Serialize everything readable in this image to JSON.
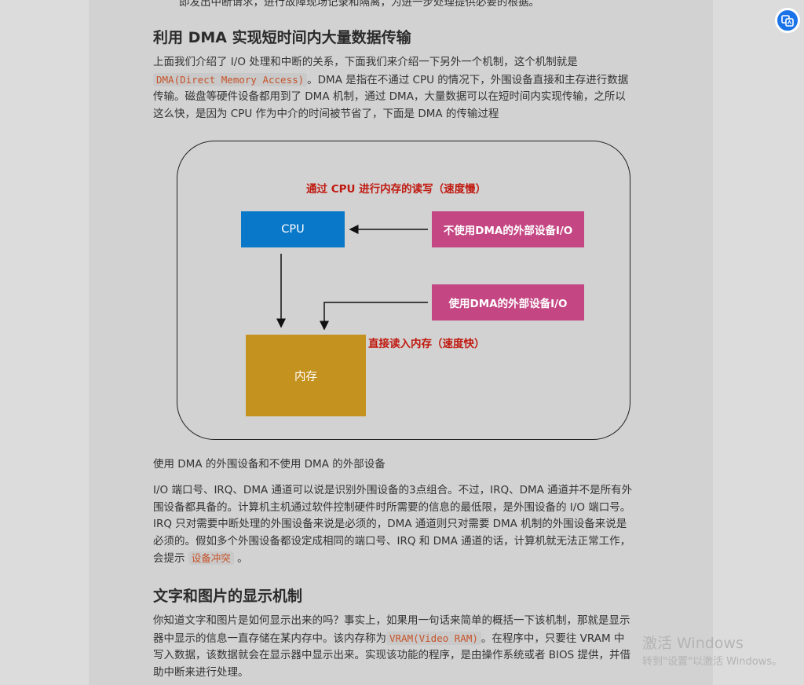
{
  "article": {
    "partial_top_line": "即发出中断请求，进行故障现场记录和隔离，为进一步处理提供必要的根据。",
    "section1": {
      "heading": "利用 DMA 实现短时间内大量数据传输",
      "p1_line1": "上面我们介绍了 I/O 处理和中断的关系，下面我们来介绍一下另外一个机制，这个机制就是",
      "p1_code": "DMA(Direct Memory Access)",
      "p1_line2_rest": "。DMA 是指在不通过 CPU 的情况下，外围设备直接和主存进行数据",
      "p1_line3": "传输。磁盘等硬件设备都用到了 DMA 机制，通过 DMA，大量数据可以在短时间内实现传输，之所以",
      "p1_line4": "这么快，是因为 CPU 作为中介的时间被节省了，下面是 DMA 的传输过程"
    },
    "diagram": {
      "title_slow": "通过 CPU 进行内存的读写（速度慢）",
      "cpu_label": "CPU",
      "no_dma_device": "不使用DMA的外部设备I/O",
      "dma_device": "使用DMA的外部设备I/O",
      "direct_label": "直接读入内存（速度快）",
      "memory_label": "内存",
      "colors": {
        "cpu": "#0a78c8",
        "device": "#c44683",
        "memory": "#c4921f",
        "red_text": "#c0190f"
      }
    },
    "caption": "使用 DMA 的外围设备和不使用 DMA 的外部设备",
    "p2": {
      "line1": "I/O 端口号、IRQ、DMA 通道可以说是识别外围设备的3点组合。不过，IRQ、DMA 通道并不是所有外",
      "line2": "围设备都具备的。计算机主机通过软件控制硬件时所需要的信息的最低限，是外围设备的 I/O 端口号。",
      "line3": "IRQ 只对需要中断处理的外围设备来说是必须的，DMA 通道则只对需要 DMA 机制的外围设备来说是",
      "line4": "必须的。假如多个外围设备都设定成相同的端口号、IRQ 和 DMA 通道的话，计算机就无法正常工作，",
      "line5_prefix": "会提示",
      "line5_code": "设备冲突",
      "line5_suffix": "。"
    },
    "section2": {
      "heading": "文字和图片的显示机制",
      "line1": "你知道文字和图片是如何显示出来的吗？事实上，如果用一句话来简单的概括一下该机制，那就是显示",
      "line2_prefix": "器中显示的信息一直存储在某内存中。该内存称为",
      "line2_code": "VRAM(Video RAM)",
      "line2_suffix": "。在程序中，只要往 VRAM 中",
      "line3": "写入数据，该数据就会在显示器中显示出来。实现该功能的程序，是由操作系统或者 BIOS 提供，并借",
      "line4": "助中断来进行处理。"
    }
  },
  "watermark": {
    "title": "激活 Windows",
    "subtitle": "转到\"设置\"以激活 Windows。"
  },
  "float_button": {
    "icon": "translate-icon",
    "color": "#1a73e8"
  }
}
